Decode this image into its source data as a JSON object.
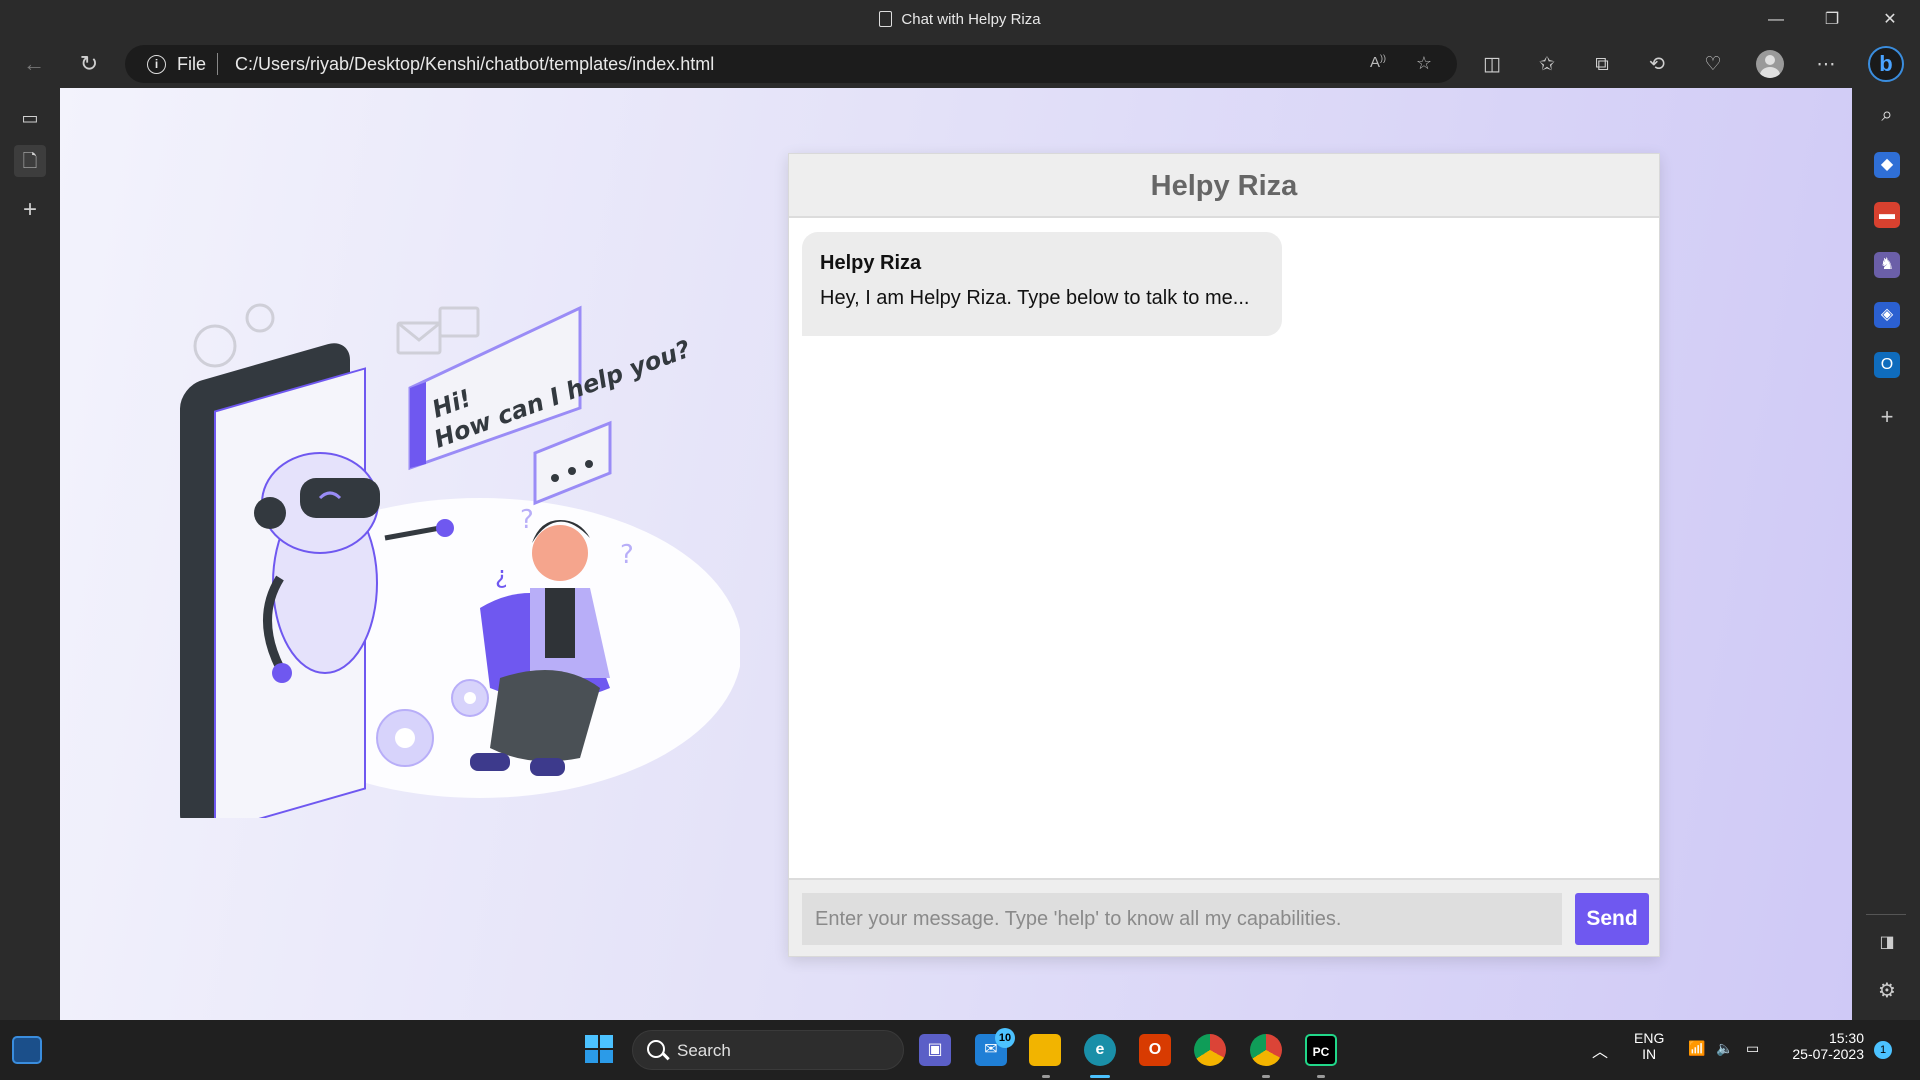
{
  "window": {
    "title": "Chat with Helpy Riza",
    "minimize_icon": "—",
    "restore_icon": "❐",
    "close_icon": "✕"
  },
  "addressbar": {
    "scheme_label": "File",
    "url": "C:/Users/riyab/Desktop/Kenshi/chatbot/templates/index.html"
  },
  "chat": {
    "header_title": "Helpy Riza",
    "messages": [
      {
        "sender": "Helpy Riza",
        "text": "Hey, I am Helpy Riza. Type below to talk to me..."
      }
    ],
    "input_placeholder": "Enter your message. Type 'help' to know all my capabilities.",
    "send_label": "Send",
    "accent_color": "#6f58f0"
  },
  "illustration": {
    "speech_text_line1": "Hi!",
    "speech_text_line2": "How can I help you?"
  },
  "taskbar": {
    "search_label": "Search",
    "mail_badge": "10",
    "language_line1": "ENG",
    "language_line2": "IN",
    "time": "15:30",
    "date": "25-07-2023",
    "notification_count": "1"
  }
}
